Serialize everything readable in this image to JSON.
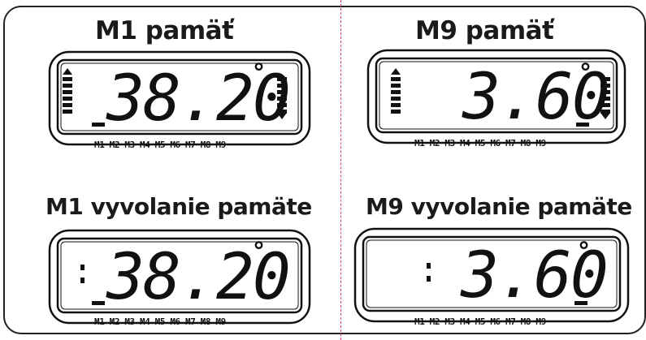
{
  "panels": [
    {
      "title": "M1 pamäť",
      "display": "38.20",
      "degree": "°",
      "memory_labels": "M1 M2 M3 M4 M5 M6 M7 M8 M9"
    },
    {
      "title": "M9 pamäť",
      "display": "3.60",
      "degree": "°",
      "memory_labels": "M1 M2 M3 M4 M5 M6 M7 M8 M9"
    },
    {
      "title": "M1 vyvolanie pamäte",
      "display": "38.20",
      "degree": "°",
      "memory_labels": "M1 M2 M3 M4 M5 M6 M7 M8 M9"
    },
    {
      "title": "M9 vyvolanie pamäte",
      "display": "3.60",
      "degree": "°",
      "memory_labels": "M1 M2 M3 M4 M5 M6 M7 M8 M9"
    }
  ],
  "colors": {
    "divider": "#d63b8a",
    "ink": "#111111"
  }
}
